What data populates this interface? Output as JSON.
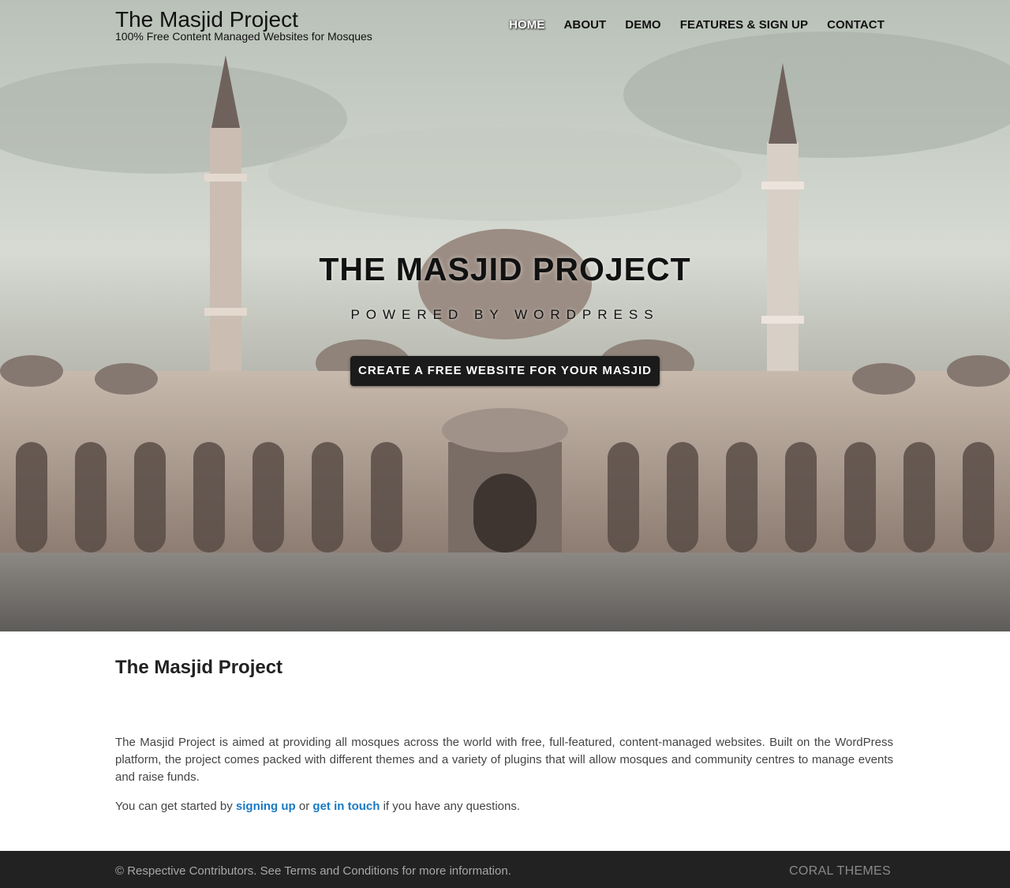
{
  "header": {
    "site_title": "The Masjid Project",
    "tagline": "100% Free Content Managed Websites for Mosques",
    "nav": [
      {
        "label": "HOME",
        "active": true
      },
      {
        "label": "ABOUT",
        "active": false
      },
      {
        "label": "DEMO",
        "active": false
      },
      {
        "label": "FEATURES & SIGN UP",
        "active": false
      },
      {
        "label": "CONTACT",
        "active": false
      }
    ]
  },
  "hero": {
    "title": "THE MASJID PROJECT",
    "subtitle": "POWERED BY WORDPRESS",
    "cta_label": "CREATE A FREE WEBSITE FOR YOUR MASJID"
  },
  "main": {
    "heading": "The Masjid Project",
    "intro": "The Masjid Project is aimed at providing all mosques across the world with free, full-featured, content-managed websites. Built on the WordPress platform, the project comes packed with different themes and a variety of plugins that will allow mosques and community centres to manage events and raise funds.",
    "start_prefix": "You can get started by ",
    "signup_link": "signing up",
    "or_text": " or ",
    "contact_link": "get in touch",
    "start_suffix": " if you have any questions."
  },
  "footer": {
    "copyright": "© Respective Contributors. See Terms and Conditions for more information.",
    "brand": "CORAL THEMES"
  },
  "colors": {
    "link": "#1a7ac4",
    "footer_bg": "#222222",
    "cta_bg": "#1b1b1b"
  }
}
